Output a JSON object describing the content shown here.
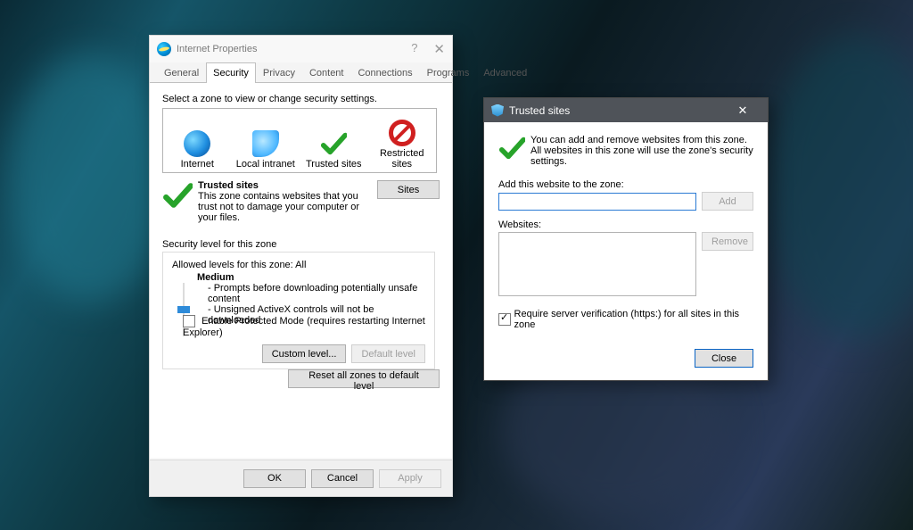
{
  "ip": {
    "title": "Internet Properties",
    "tabs": [
      "General",
      "Security",
      "Privacy",
      "Content",
      "Connections",
      "Programs",
      "Advanced"
    ],
    "selected_tab": 1,
    "zone_instruction": "Select a zone to view or change security settings.",
    "zones": [
      "Internet",
      "Local intranet",
      "Trusted sites",
      "Restricted sites"
    ],
    "zone_title": "Trusted sites",
    "zone_desc": "This zone contains websites that you trust not to damage your computer or your files.",
    "sites_btn": "Sites",
    "sec_caption": "Security level for this zone",
    "allowed": "Allowed levels for this zone: All",
    "level_name": "Medium",
    "level_line1": "- Prompts before downloading potentially unsafe content",
    "level_line2": "- Unsigned ActiveX controls will not be downloaded",
    "protected_mode": "Enable Protected Mode (requires restarting Internet Explorer)",
    "custom_btn": "Custom level...",
    "default_btn": "Default level",
    "reset_btn": "Reset all zones to default level",
    "ok": "OK",
    "cancel": "Cancel",
    "apply": "Apply"
  },
  "ts": {
    "title": "Trusted sites",
    "intro": "You can add and remove websites from this zone. All websites in this zone will use the zone's security settings.",
    "add_label": "Add this website to the zone:",
    "add_btn": "Add",
    "websites_label": "Websites:",
    "remove_btn": "Remove",
    "require": "Require server verification (https:) for all sites in this zone",
    "close": "Close"
  }
}
